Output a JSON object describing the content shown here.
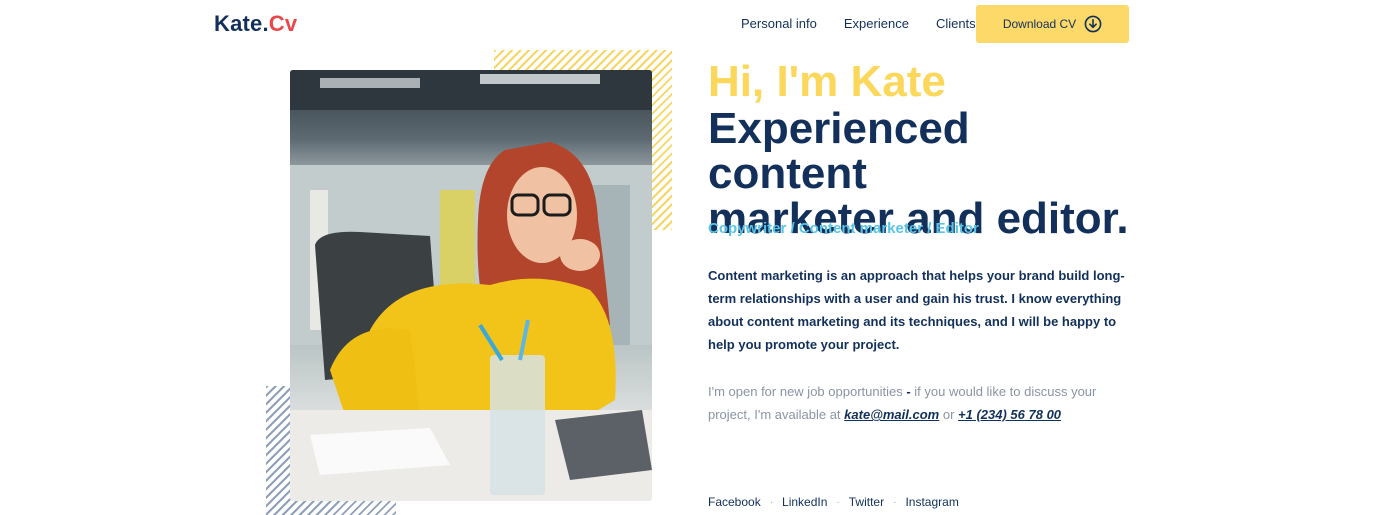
{
  "brand": {
    "name": "Kate.",
    "accent": "Cv"
  },
  "nav": {
    "items": [
      "Personal info",
      "Experience",
      "Clients"
    ],
    "download_label": "Download CV"
  },
  "hero": {
    "greeting": "Hi, I'm Kate",
    "headline_line1": "Experienced content",
    "headline_line2": "marketer and editor.",
    "role": "Copywriter / Content marketer / Editor",
    "intro": "Content marketing is an approach that helps your brand build long-term relationships with a user and gain his trust. I know everything about content marketing and its techniques, and I will be happy to help you promote your project.",
    "contact_prefix": "I'm open for new job opportunities",
    "contact_dash": " - ",
    "contact_middle": "if you would like to discuss your project, I'm available at ",
    "email": "kate@mail.com",
    "contact_or": " or ",
    "phone_plus": "+",
    "phone": "1 (234) 56 78 00"
  },
  "social": [
    "Facebook",
    "LinkedIn",
    "Twitter",
    "Instagram"
  ],
  "colors": {
    "navy": "#12305a",
    "yellow": "#fbd85b",
    "button_yellow": "#fdd96a",
    "cyan": "#58c4e6",
    "logo_red": "#e8484a"
  },
  "icons": {
    "download": "arrow-down-circle-icon"
  }
}
